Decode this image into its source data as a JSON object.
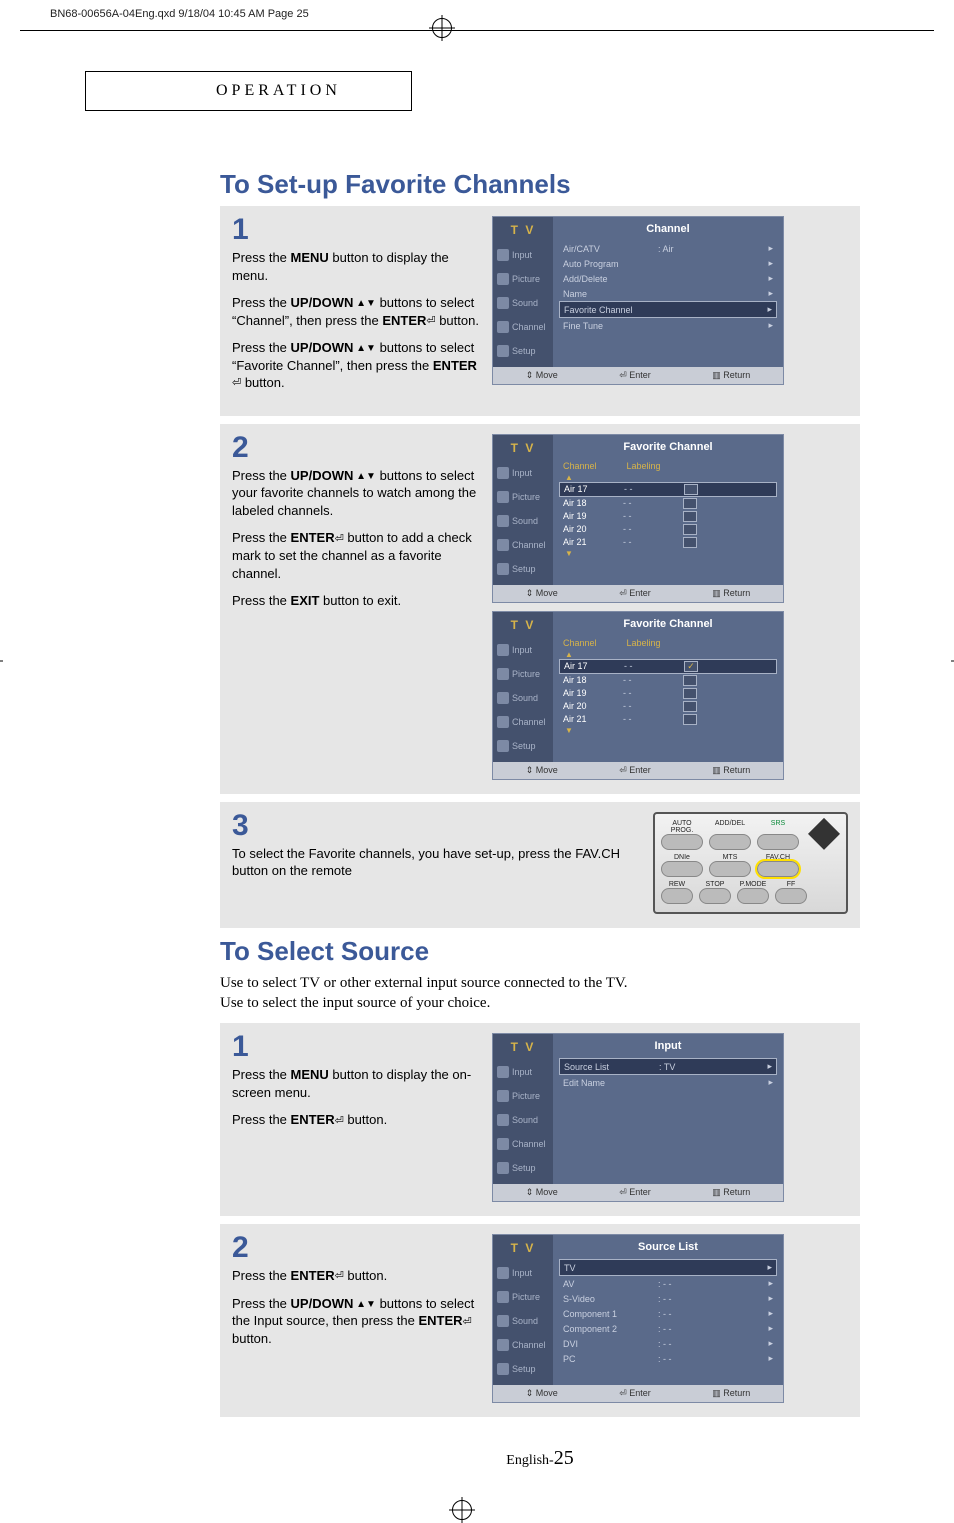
{
  "printHeader": "BN68-00656A-04Eng.qxd  9/18/04 10:45 AM  Page 25",
  "operationLabel": "OPERATION",
  "title1": "To Set-up Favorite Channels",
  "title2": "To Select Source",
  "intro2_line1": "Use to select TV or other external input source connected to the TV.",
  "intro2_line2": "Use to select the input source of your choice.",
  "pageFootPrefix": "English-",
  "pageNumber": "25",
  "steps1": {
    "s1": {
      "num": "1",
      "p1a": "Press the ",
      "p1b": "MENU",
      "p1c": " button to display the menu.",
      "p2a": "Press the ",
      "p2b": "UP/DOWN",
      "p2c": " buttons to select “Channel”, then press the ",
      "p2d": "ENTER",
      "p2e": " button.",
      "p3a": "Press the ",
      "p3b": "UP/DOWN",
      "p3c": " buttons to select “Favorite Channel”, then press the ",
      "p3d": "ENTER",
      "p3e": " button."
    },
    "s2": {
      "num": "2",
      "p1a": "Press the ",
      "p1b": "UP/DOWN",
      "p1c": " buttons to select your favorite channels to watch among the labeled channels.",
      "p2a": "Press the ",
      "p2b": "ENTER",
      "p2c": " button to add a check mark to set the channel as a favorite channel.",
      "p3a": "Press the ",
      "p3b": "EXIT",
      "p3c": " button to exit."
    },
    "s3": {
      "num": "3",
      "p1": "To select the Favorite channels, you have set-up, press the FAV.CH button on the remote"
    }
  },
  "steps2": {
    "s1": {
      "num": "1",
      "p1a": "Press the ",
      "p1b": "MENU",
      "p1c": " button to display the on-screen menu.",
      "p2a": "Press the ",
      "p2b": "ENTER",
      "p2c": " button."
    },
    "s2": {
      "num": "2",
      "p1a": "Press the ",
      "p1b": "ENTER",
      "p1c": " button.",
      "p2a": "Press the ",
      "p2b": "UP/DOWN",
      "p2c": " buttons to select the Input source, then press the ",
      "p2d": "ENTER",
      "p2e": " button."
    }
  },
  "osd": {
    "tv": "T V",
    "cats": [
      "Input",
      "Picture",
      "Sound",
      "Channel",
      "Setup"
    ],
    "hints": {
      "move": "Move",
      "enter": "Enter",
      "return": "Return"
    },
    "channel": {
      "head": "Channel",
      "rows": [
        {
          "k": "Air/CATV",
          "v": ": Air",
          "sel": false
        },
        {
          "k": "Auto Program",
          "v": "",
          "sel": false
        },
        {
          "k": "Add/Delete",
          "v": "",
          "sel": false
        },
        {
          "k": "Name",
          "v": "",
          "sel": false
        },
        {
          "k": "Favorite  Channel",
          "v": "",
          "sel": true
        },
        {
          "k": "Fine Tune",
          "v": "",
          "sel": false
        }
      ]
    },
    "fav": {
      "head": "Favorite Channel",
      "cols": [
        "Channel",
        "Labeling"
      ],
      "listA": [
        {
          "ch": "Air  17",
          "lbl": "- -",
          "sel": true,
          "checked": false
        },
        {
          "ch": "Air  18",
          "lbl": "- -",
          "sel": false,
          "checked": false
        },
        {
          "ch": "Air  19",
          "lbl": "- -",
          "sel": false,
          "checked": false
        },
        {
          "ch": "Air  20",
          "lbl": "- -",
          "sel": false,
          "checked": false
        },
        {
          "ch": "Air  21",
          "lbl": "- -",
          "sel": false,
          "checked": false
        }
      ],
      "listB": [
        {
          "ch": "Air  17",
          "lbl": "- -",
          "sel": true,
          "checked": true
        },
        {
          "ch": "Air  18",
          "lbl": "- -",
          "sel": false,
          "checked": false
        },
        {
          "ch": "Air  19",
          "lbl": "- -",
          "sel": false,
          "checked": false
        },
        {
          "ch": "Air  20",
          "lbl": "- -",
          "sel": false,
          "checked": false
        },
        {
          "ch": "Air  21",
          "lbl": "- -",
          "sel": false,
          "checked": false
        }
      ]
    },
    "input": {
      "head": "Input",
      "rows": [
        {
          "k": "Source List",
          "v": ": TV",
          "sel": true
        },
        {
          "k": "Edit Name",
          "v": "",
          "sel": false
        }
      ]
    },
    "sourceList": {
      "head": "Source List",
      "rows": [
        {
          "k": "TV",
          "v": "",
          "sel": true
        },
        {
          "k": "AV",
          "v": ": - -",
          "sel": false
        },
        {
          "k": "S-Video",
          "v": ": - -",
          "sel": false
        },
        {
          "k": "Component 1",
          "v": ": - -",
          "sel": false
        },
        {
          "k": "Component 2",
          "v": ": - -",
          "sel": false
        },
        {
          "k": "DVI",
          "v": ": - -",
          "sel": false
        },
        {
          "k": "PC",
          "v": ": - -",
          "sel": false
        }
      ]
    }
  },
  "remote": {
    "topLabels": [
      "AUTO PROG.",
      "ADD/DEL",
      "SRS"
    ],
    "row2": [
      "DNIe",
      "MTS",
      "FAV.CH"
    ],
    "row3": [
      "REW",
      "STOP",
      "P.MODE",
      "FF"
    ]
  }
}
